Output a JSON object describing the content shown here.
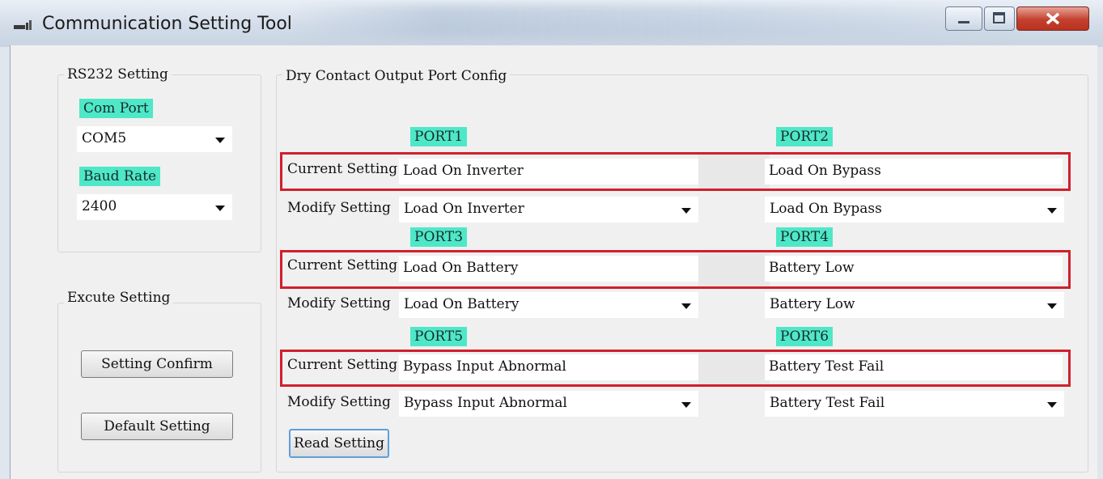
{
  "window": {
    "title": "Communication Setting Tool"
  },
  "rs232": {
    "group_label": "RS232 Setting",
    "com_port_label": "Com Port",
    "com_port_value": "COM5",
    "baud_rate_label": "Baud Rate",
    "baud_rate_value": "2400"
  },
  "execute": {
    "group_label": "Excute Setting",
    "confirm_label": "Setting Confirm",
    "default_label": "Default Setting"
  },
  "dry_contact": {
    "group_label": "Dry Contact Output Port Config",
    "current_label": "Current Setting",
    "modify_label": "Modify Setting",
    "read_label": "Read Setting",
    "ports": [
      {
        "name": "PORT1",
        "current": "Load On Inverter",
        "modify": "Load On Inverter"
      },
      {
        "name": "PORT2",
        "current": "Load On Bypass",
        "modify": "Load On Bypass"
      },
      {
        "name": "PORT3",
        "current": "Load On Battery",
        "modify": "Load On Battery"
      },
      {
        "name": "PORT4",
        "current": "Battery Low",
        "modify": "Battery Low"
      },
      {
        "name": "PORT5",
        "current": "Bypass Input Abnormal",
        "modify": "Bypass Input Abnormal"
      },
      {
        "name": "PORT6",
        "current": "Battery Test Fail",
        "modify": "Battery Test Fail"
      }
    ]
  },
  "colors": {
    "highlight": "#4ee8c8",
    "red_box": "#d0202c"
  },
  "icons": [
    "app-icon",
    "minimize-icon",
    "maximize-icon",
    "close-icon",
    "dropdown-arrow-icon"
  ]
}
